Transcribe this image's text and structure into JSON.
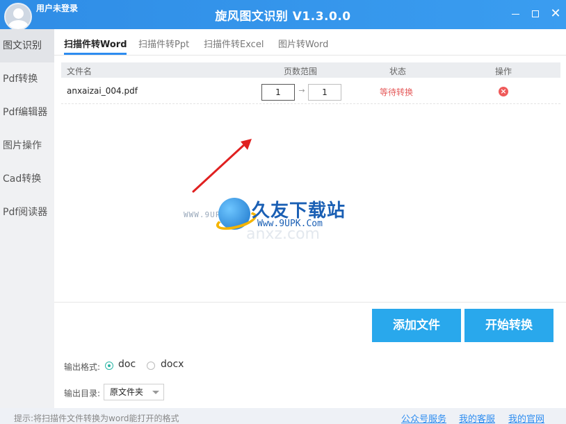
{
  "window": {
    "user_label": "用户未登录",
    "title": "旋风图文识别 V1.3.0.0"
  },
  "sidebar": {
    "items": [
      {
        "label": "图文识别",
        "active": true
      },
      {
        "label": "Pdf转换"
      },
      {
        "label": "Pdf编辑器"
      },
      {
        "label": "图片操作"
      },
      {
        "label": "Cad转换"
      },
      {
        "label": "Pdf阅读器"
      }
    ]
  },
  "tabs": [
    {
      "label": "扫描件转Word",
      "active": true
    },
    {
      "label": "扫描件转Ppt"
    },
    {
      "label": "扫描件转Excel"
    },
    {
      "label": "图片转Word"
    }
  ],
  "table": {
    "headers": {
      "name": "文件名",
      "pages": "页数范围",
      "status": "状态",
      "action": "操作"
    },
    "rows": [
      {
        "name": "anxaizai_004.pdf",
        "page_from": "1",
        "page_to": "1",
        "status": "等待转换"
      }
    ]
  },
  "watermark": {
    "brand": "久友下载站",
    "url": "Www.9UPK.Com",
    "side_url": "WWW.9UPK.COM",
    "faded": "anxz.com"
  },
  "buttons": {
    "add_file": "添加文件",
    "start_convert": "开始转换"
  },
  "output_format": {
    "label": "输出格式:",
    "options": [
      "doc",
      "docx"
    ],
    "selected": "doc"
  },
  "output_dir": {
    "label": "输出目录:",
    "value": "原文件夹"
  },
  "statusbar": {
    "hint": "提示:将扫描件文件转换为word能打开的格式",
    "links": [
      "公众号服务",
      "我的客服",
      "我的官网"
    ]
  },
  "colors": {
    "titlebar": "#2f8de6",
    "accent_button": "#29a8ec",
    "status_pending": "#e55a5a",
    "arrow": "#e02020"
  }
}
